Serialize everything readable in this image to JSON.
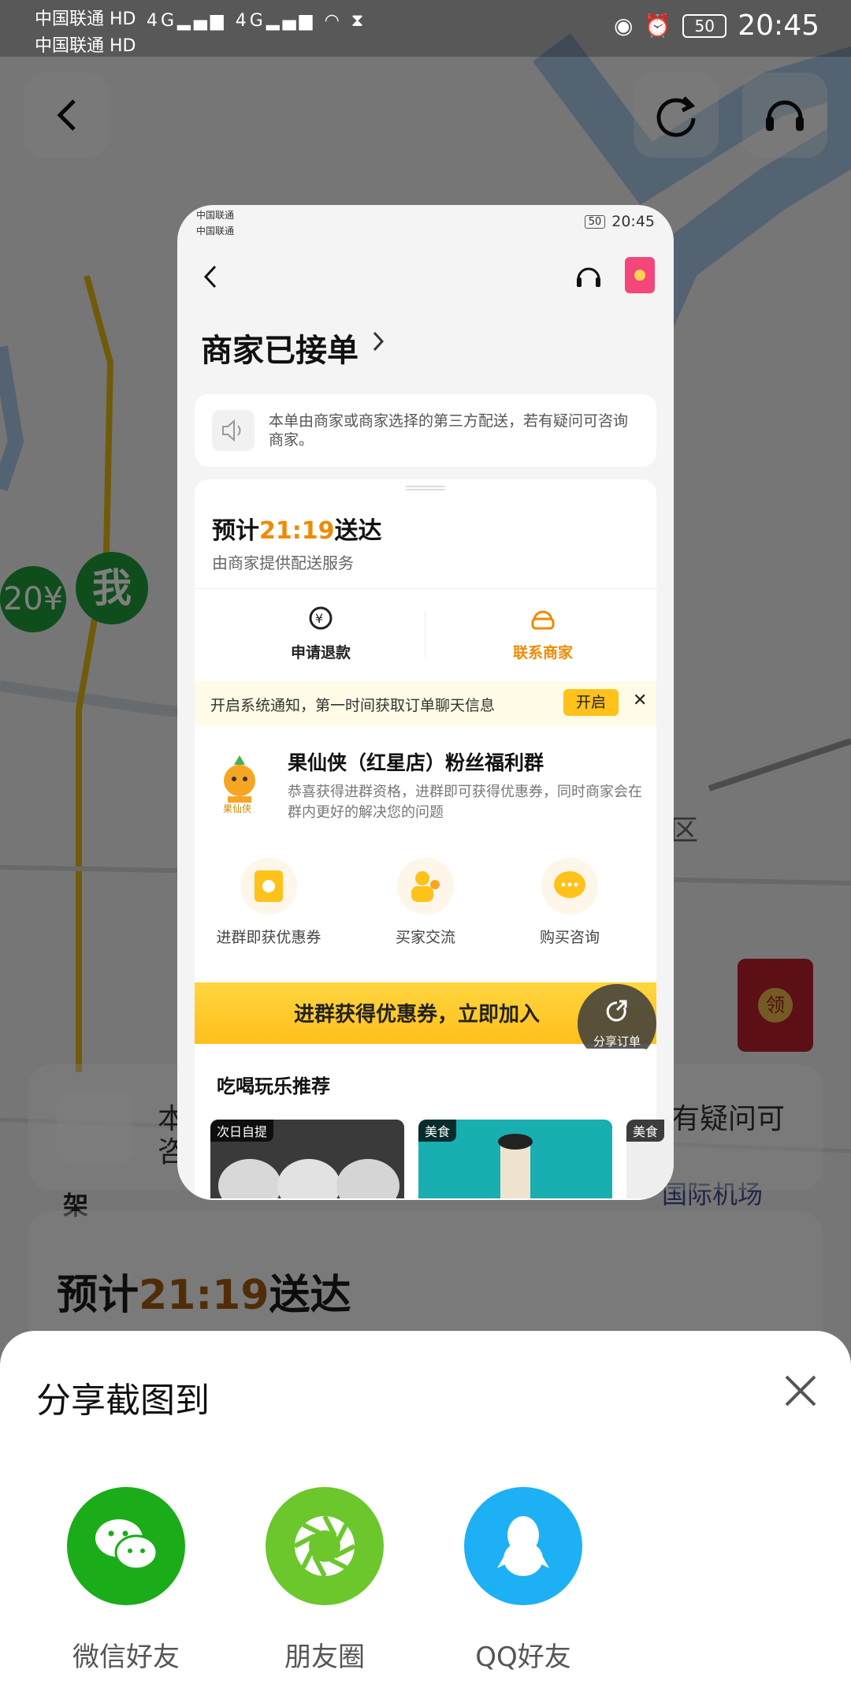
{
  "status_bar": {
    "carrier1": "中国联通",
    "carrier2": "中国联通",
    "hd": "HD",
    "network": "4G",
    "battery": "50",
    "time": "20:45"
  },
  "map_background": {
    "marker_price": "20¥",
    "marker_me": "我",
    "envelope_char": "领",
    "label_airport": "国际机场",
    "label_district": "区",
    "label_jia": "架",
    "notice_fragment_left": "本",
    "notice_fragment_left2": "咨",
    "notice_fragment_right": "有疑问可",
    "eta_prefix": "预计",
    "eta_time": "21:19",
    "eta_suffix": "送达"
  },
  "preview": {
    "status": {
      "carrier1": "中国联通",
      "carrier2": "中国联通",
      "time": "20:45",
      "battery": "50"
    },
    "page_title": "商家已接单",
    "notice": "本单由商家或商家选择的第三方配送，若有疑问可咨询商家。",
    "eta_prefix": "预计",
    "eta_time": "21:19",
    "eta_suffix": "送达",
    "eta_sub": "由商家提供配送服务",
    "actions": {
      "refund": "申请退款",
      "contact": "联系商家"
    },
    "tip": {
      "text": "开启系统通知，第一时间获取订单聊天信息",
      "button": "开启",
      "close": "✕"
    },
    "group": {
      "logo_text": "果仙侠",
      "name": "果仙侠（红星店）粉丝福利群",
      "desc": "恭喜获得进群资格，进群即可获得优惠券，同时商家会在群内更好的解决您的问题",
      "features": [
        "进群即获优惠券",
        "买家交流",
        "购买咨询"
      ],
      "join": "进群获得优惠券，立即加入"
    },
    "share_order": "分享订单",
    "recommend": {
      "title": "吃喝玩乐推荐",
      "tags": [
        "次日自提",
        "美食",
        "美食"
      ]
    }
  },
  "share_sheet": {
    "title": "分享截图到",
    "targets": [
      "微信好友",
      "朋友圈",
      "QQ好友"
    ],
    "colors": {
      "wechat": "#1aad19",
      "moments": "#6bc72c",
      "qq": "#1eb0f5"
    }
  },
  "accent_color": "#f08a00"
}
